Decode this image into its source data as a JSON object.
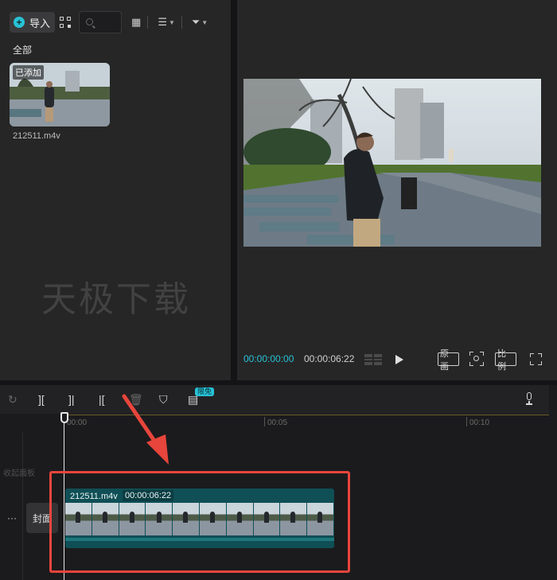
{
  "media": {
    "import_label": "导入",
    "all_label": "全部",
    "thumb_badge": "已添加",
    "file_name": "212511.m4v",
    "watermark": "天极下载"
  },
  "player": {
    "time_current": "00:00:00:00",
    "time_total": "00:00:06:22",
    "btn_original": "原画",
    "btn_ratio": "比例"
  },
  "timeline": {
    "badge_free": "限免",
    "ruler_ticks": [
      "00:00",
      "00:05",
      "00:10"
    ],
    "collapse_label": "收起面板",
    "track_dots": "···",
    "cover_label": "封面",
    "clip_name": "212511.m4v",
    "clip_duration": "00:00:06:22"
  },
  "colors": {
    "accent": "#27c2d6",
    "annotation": "#e8453c"
  }
}
